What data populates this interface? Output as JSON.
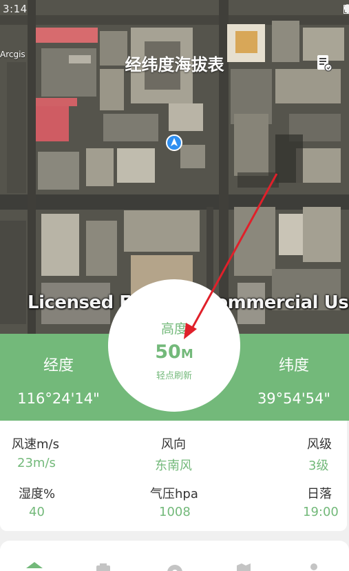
{
  "status_bar": {
    "time": "3:14"
  },
  "header": {
    "title": "经纬度海拔表",
    "map_source": "Arcgis",
    "menu_icon": "document-icon"
  },
  "map": {
    "watermark": "Licensed For Non-Commercial Use Only",
    "marker_icon": "navigation-arrow-icon"
  },
  "coordinates": {
    "longitude": {
      "label": "经度",
      "value": "116°24'14\""
    },
    "latitude": {
      "label": "纬度",
      "value": "39°54'54\""
    }
  },
  "altitude": {
    "label": "高度",
    "value": "50",
    "unit": "M",
    "refresh_hint": "轻点刷新"
  },
  "weather": {
    "wind_speed": {
      "label": "风速m/s",
      "value": "23m/s"
    },
    "wind_direction": {
      "label": "风向",
      "value": "东南风"
    },
    "wind_level": {
      "label": "风级",
      "value": "3级"
    },
    "humidity": {
      "label": "湿度%",
      "value": "40"
    },
    "pressure": {
      "label": "气压hpa",
      "value": "1008"
    },
    "sunset": {
      "label": "日落",
      "value": "19:00"
    }
  },
  "bottom_nav": {
    "items": [
      {
        "icon": "home-icon"
      },
      {
        "icon": "camera-icon"
      },
      {
        "icon": "compass-icon"
      },
      {
        "icon": "map-icon"
      },
      {
        "icon": "person-icon"
      }
    ]
  },
  "colors": {
    "accent_green": "#73b97a",
    "arrow_red": "#e0202a",
    "marker_blue": "#2f8ff0"
  }
}
